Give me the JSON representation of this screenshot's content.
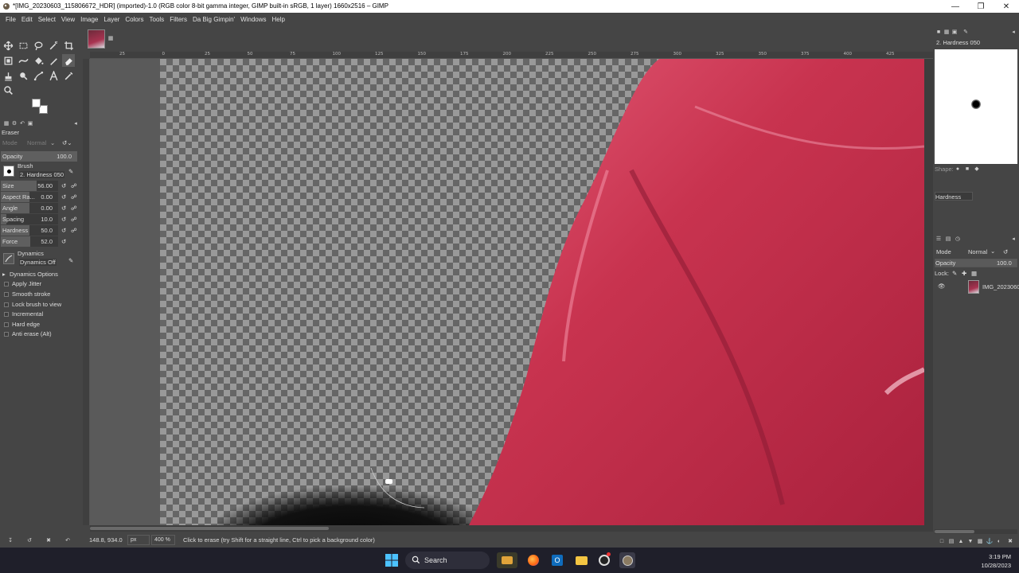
{
  "window": {
    "title": "*[IMG_20230603_115806672_HDR] (imported)-1.0 (RGB color 8-bit gamma integer, GIMP built-in sRGB, 1 layer) 1660x2516 – GIMP"
  },
  "menubar": [
    "File",
    "Edit",
    "Select",
    "View",
    "Image",
    "Layer",
    "Colors",
    "Tools",
    "Filters",
    "Da Big Gimpin'",
    "Windows",
    "Help"
  ],
  "tool_options": {
    "tool_name": "Eraser",
    "mode_label": "Mode",
    "mode_value": "Normal",
    "opacity_label": "Opacity",
    "opacity_value": "100.0",
    "opacity_fraction": 1.0,
    "brush_label": "Brush",
    "brush_name": "2. Hardness 050",
    "params": [
      {
        "label": "Size",
        "value": "56.00",
        "fraction": 0.62
      },
      {
        "label": "Aspect Ra...",
        "value": "0.00",
        "fraction": 0.5
      },
      {
        "label": "Angle",
        "value": "0.00",
        "fraction": 0.5
      },
      {
        "label": "Spacing",
        "value": "10.0",
        "fraction": 0.1
      },
      {
        "label": "Hardness",
        "value": "50.0",
        "fraction": 0.5
      },
      {
        "label": "Force",
        "value": "52.0",
        "fraction": 0.52
      }
    ],
    "dynamics_label": "Dynamics",
    "dynamics_value": "Dynamics Off",
    "dynamics_options_label": "Dynamics Options",
    "checkboxes": [
      "Apply Jitter",
      "Smooth stroke",
      "Lock brush to view",
      "Incremental",
      "Hard edge",
      "Anti erase  (Alt)"
    ]
  },
  "ruler": {
    "h_ticks": [
      "25",
      "0",
      "25",
      "50",
      "75",
      "100",
      "125",
      "150",
      "175",
      "200",
      "225",
      "250",
      "275",
      "300",
      "325",
      "350",
      "375",
      "400",
      "425"
    ]
  },
  "status": {
    "coords": "148.8, 934.0",
    "unit": "px",
    "zoom": "400 %",
    "message": "Click to erase (try Shift for a straight line, Ctrl to pick a background color)"
  },
  "brushes_dock": {
    "title": "2. Hardness 050",
    "shape_label": "Shape:",
    "hardness_label": "Hardness"
  },
  "layers_dock": {
    "mode_label": "Mode",
    "mode_value": "Normal",
    "opacity_label": "Opacity",
    "opacity_value": "100.0",
    "lock_label": "Lock:",
    "layers": [
      {
        "name": "IMG_2023060"
      }
    ]
  },
  "taskbar": {
    "search_label": "Search",
    "time": "3:19 PM",
    "date": "10/28/2023"
  }
}
